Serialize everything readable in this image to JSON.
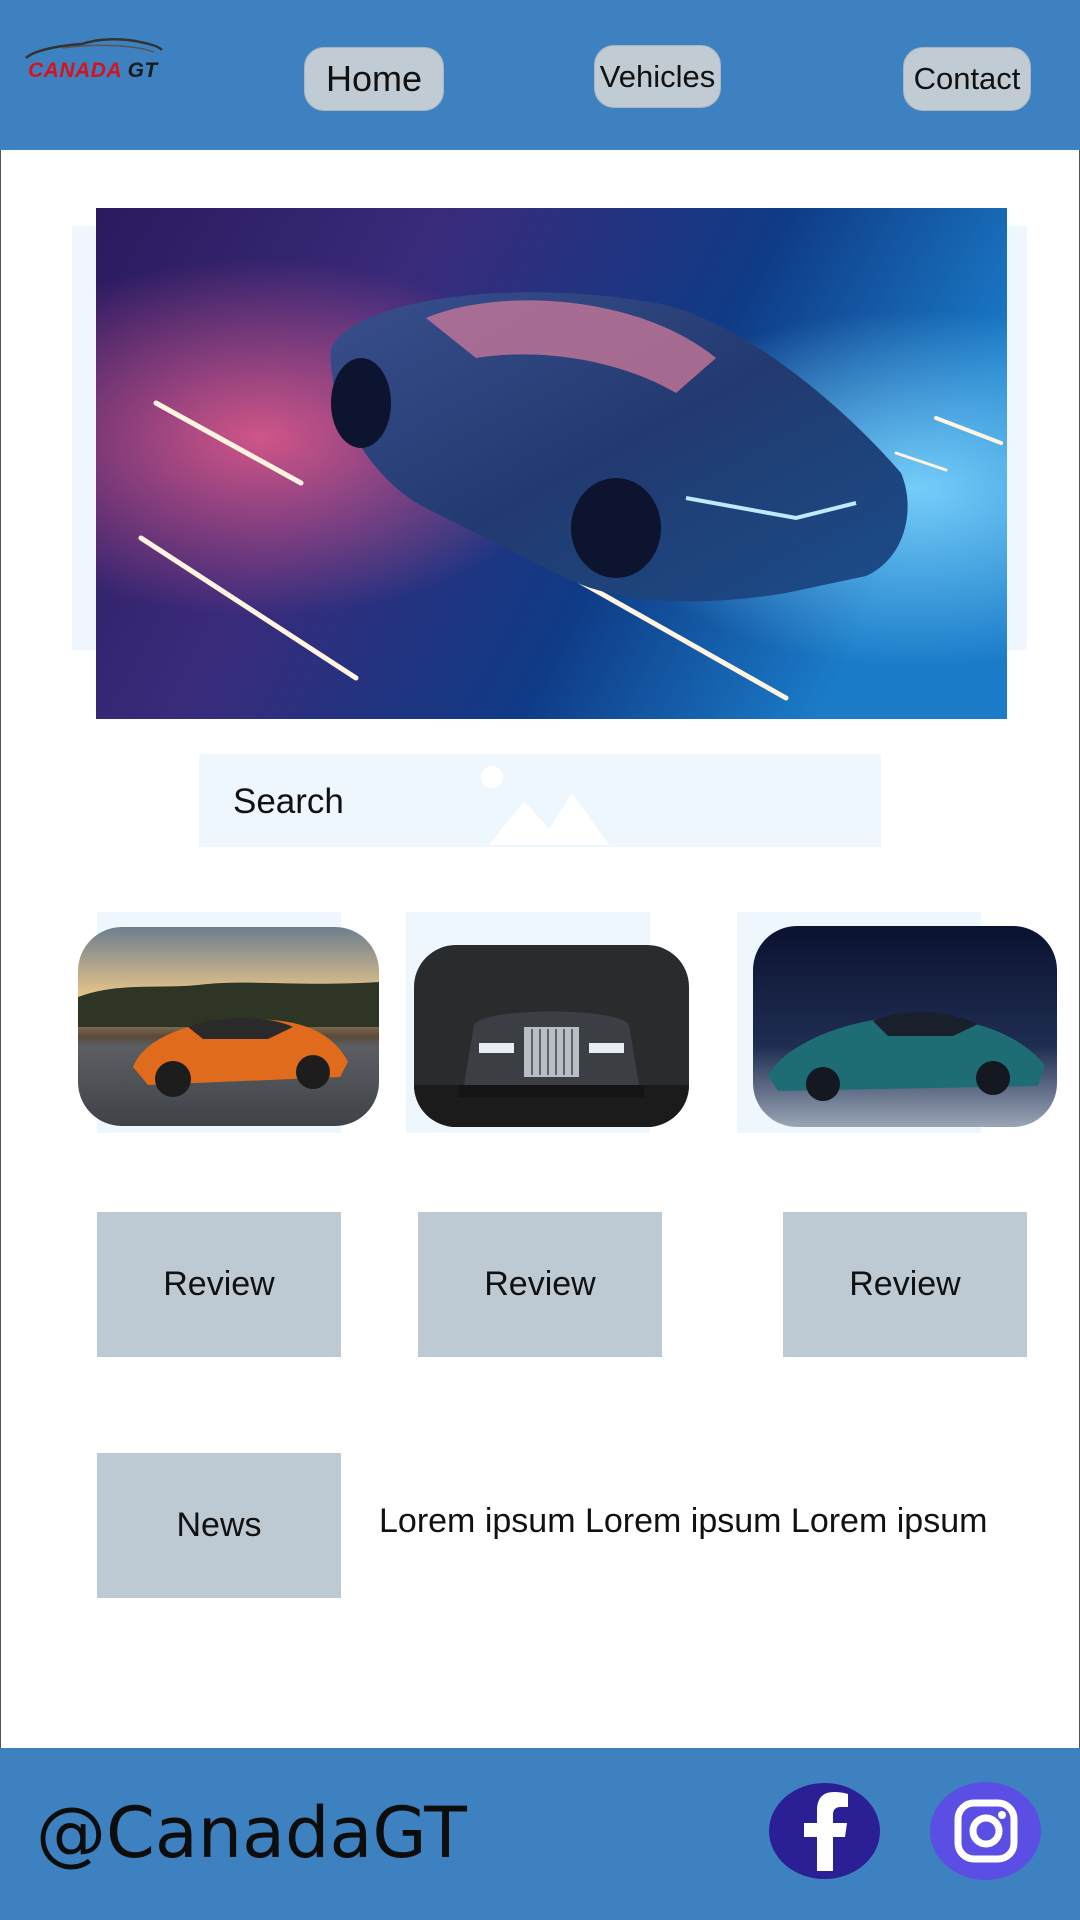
{
  "brand": {
    "logo_part1": "CANADA",
    "logo_part2": "GT"
  },
  "nav": {
    "home": "Home",
    "vehicles": "Vehicles",
    "contact": "Contact"
  },
  "search": {
    "label": "Search"
  },
  "cars": [
    {
      "name": "orange-sports-car"
    },
    {
      "name": "black-luxury-sedan"
    },
    {
      "name": "teal-hypercar"
    }
  ],
  "reviews": [
    "Review",
    "Review",
    "Review"
  ],
  "news": {
    "label": "News",
    "text": "Lorem ipsum Lorem ipsum Lorem ipsum"
  },
  "footer": {
    "handle": "@CanadaGT"
  },
  "social": {
    "facebook": "facebook-icon",
    "instagram": "instagram-icon"
  },
  "colors": {
    "header_bg": "#3e81c0",
    "button_grey": "#becad3",
    "facebook_bg": "#2b1f96",
    "instagram_bg": "#5b4ee5",
    "logo_red": "#d8121b"
  }
}
